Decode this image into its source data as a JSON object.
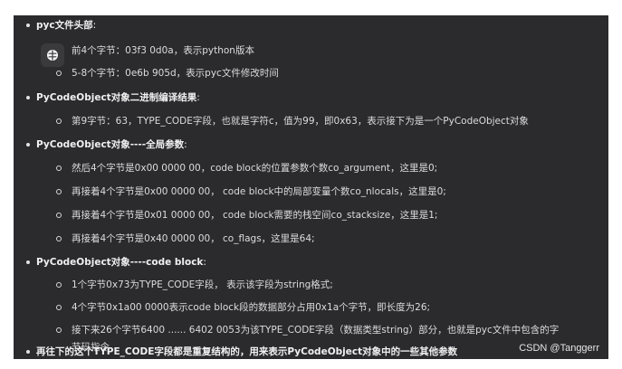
{
  "items": [
    {
      "level": 1,
      "text": "pyc文件头部",
      "tail": ":"
    },
    {
      "level": 2,
      "text": "前4个字节：03f3 0d0a，表示python版本"
    },
    {
      "level": 2,
      "text": "5-8个字节：0e6b 905d，表示pyc文件修改时间"
    },
    {
      "level": 1,
      "text": "PyCodeObject对象二进制编译结果",
      "tail": ":"
    },
    {
      "level": 2,
      "text": "第9字节：63，TYPE_CODE字段，也就是字符c，值为99，即0x63，表示接下为是一个PyCodeObject对象"
    },
    {
      "level": 1,
      "text": "PyCodeObject对象----全局参数",
      "tail": ":"
    },
    {
      "level": 2,
      "text": "然后4个字节是0x00 0000 00，code block的位置参数个数co_argument，这里是0;"
    },
    {
      "level": 2,
      "text": "再接着4个字节是0x00 0000 00， code block中的局部变量个数co_nlocals，这里是0;"
    },
    {
      "level": 2,
      "text": "再接着4个字节是0x01 0000 00， code block需要的栈空间co_stacksize，这里是1;"
    },
    {
      "level": 2,
      "text": "再接着4个字节是0x40 0000 00， co_flags，这里是64;"
    },
    {
      "level": 1,
      "text": "PyCodeObject对象----code block",
      "tail": ":"
    },
    {
      "level": 2,
      "text": "1个字节0x73为TYPE_CODE字段， 表示该字段为string格式;"
    },
    {
      "level": 2,
      "text": "4个字节0x1a00 0000表示code block段的数据部分占用0x1a个字节，即长度为26;"
    },
    {
      "level": 2,
      "text": "接下来26个字节6400 ...... 6402 0053为该TYPE_CODE字段（数据类型string）部分，也就是pyc文件中包含的字",
      "cont": "节码指令"
    },
    {
      "level": 1,
      "text": "再往下的这个TYPE_CODE字段都是重复结构的，用来表示PyCodeObject对象中的一些其他参数"
    }
  ],
  "watermark": "CSDN @Tanggerr",
  "icon": "brain-icon",
  "colors": {
    "background": "#2b2b2e",
    "text": "#e3e3e3"
  }
}
